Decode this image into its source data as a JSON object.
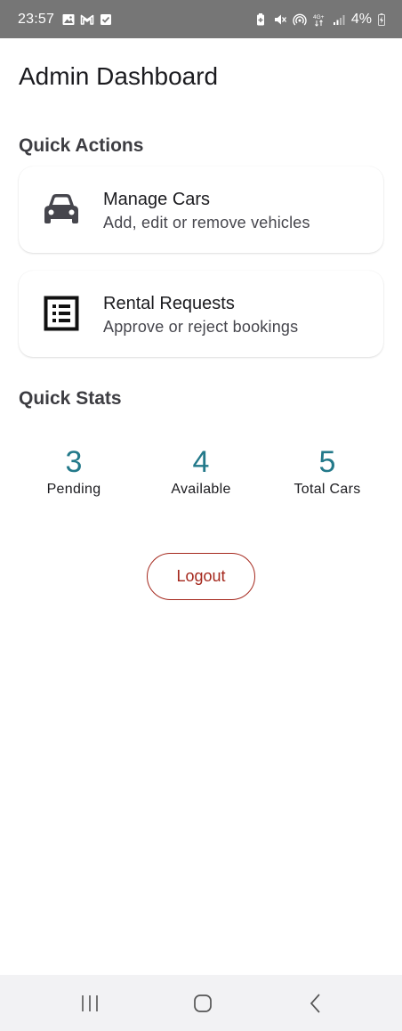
{
  "status_bar": {
    "time": "23:57",
    "battery": "4%",
    "left_icons": [
      "image-icon",
      "gmail-icon",
      "check-box-icon"
    ],
    "right_icons": [
      "battery-saver-icon",
      "mute-icon",
      "hotspot-icon",
      "4g-icon",
      "signal-icon",
      "charging-icon"
    ]
  },
  "header": {
    "title": "Admin Dashboard"
  },
  "quick_actions": {
    "title": "Quick Actions",
    "items": [
      {
        "icon": "car-icon",
        "title": "Manage Cars",
        "subtitle": "Add, edit or remove vehicles"
      },
      {
        "icon": "list-icon",
        "title": "Rental Requests",
        "subtitle": "Approve or reject bookings"
      }
    ]
  },
  "quick_stats": {
    "title": "Quick Stats",
    "items": [
      {
        "value": "3",
        "label": "Pending"
      },
      {
        "value": "4",
        "label": "Available"
      },
      {
        "value": "5",
        "label": "Total Cars"
      }
    ]
  },
  "logout": {
    "label": "Logout"
  },
  "colors": {
    "accent": "#23798a",
    "danger": "#a5281d",
    "status_bar": "#767676"
  },
  "nav_bar": {
    "icons": [
      "recents-icon",
      "home-icon",
      "back-icon"
    ]
  }
}
